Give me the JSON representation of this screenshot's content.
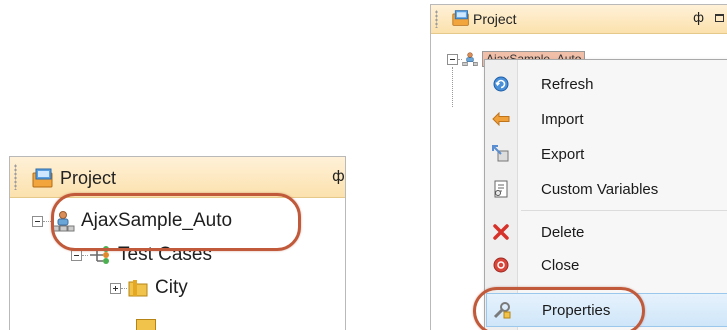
{
  "left_panel": {
    "title": "Project",
    "pin_glyph": "ф",
    "tree": [
      {
        "label": "AjaxSample_Auto",
        "icon": "project-node-icon",
        "expander": "minus"
      },
      {
        "label": "Test Cases",
        "icon": "test-cases-icon",
        "expander": "minus"
      },
      {
        "label": "City",
        "icon": "folder-icon",
        "expander": "plus"
      }
    ]
  },
  "right_panel": {
    "title": "Project",
    "pin_glyph": "ф",
    "tree_root_label": "AjaxSample_Auto",
    "context_menu": {
      "items": [
        {
          "label": "Refresh",
          "icon": "refresh-icon"
        },
        {
          "label": "Import",
          "icon": "import-arrow-icon"
        },
        {
          "label": "Export",
          "icon": "export-icon"
        },
        {
          "label": "Custom Variables",
          "icon": "custom-variables-icon"
        },
        {
          "label": "Delete",
          "icon": "delete-x-icon"
        },
        {
          "label": "Close",
          "icon": "close-circle-icon"
        },
        {
          "label": "Properties",
          "icon": "properties-icon",
          "selected": true
        }
      ]
    }
  },
  "colors": {
    "highlight_oval": "#c05a3a",
    "titlebar": "#fbe1ad",
    "menu_selected": "#cfe6f9"
  }
}
